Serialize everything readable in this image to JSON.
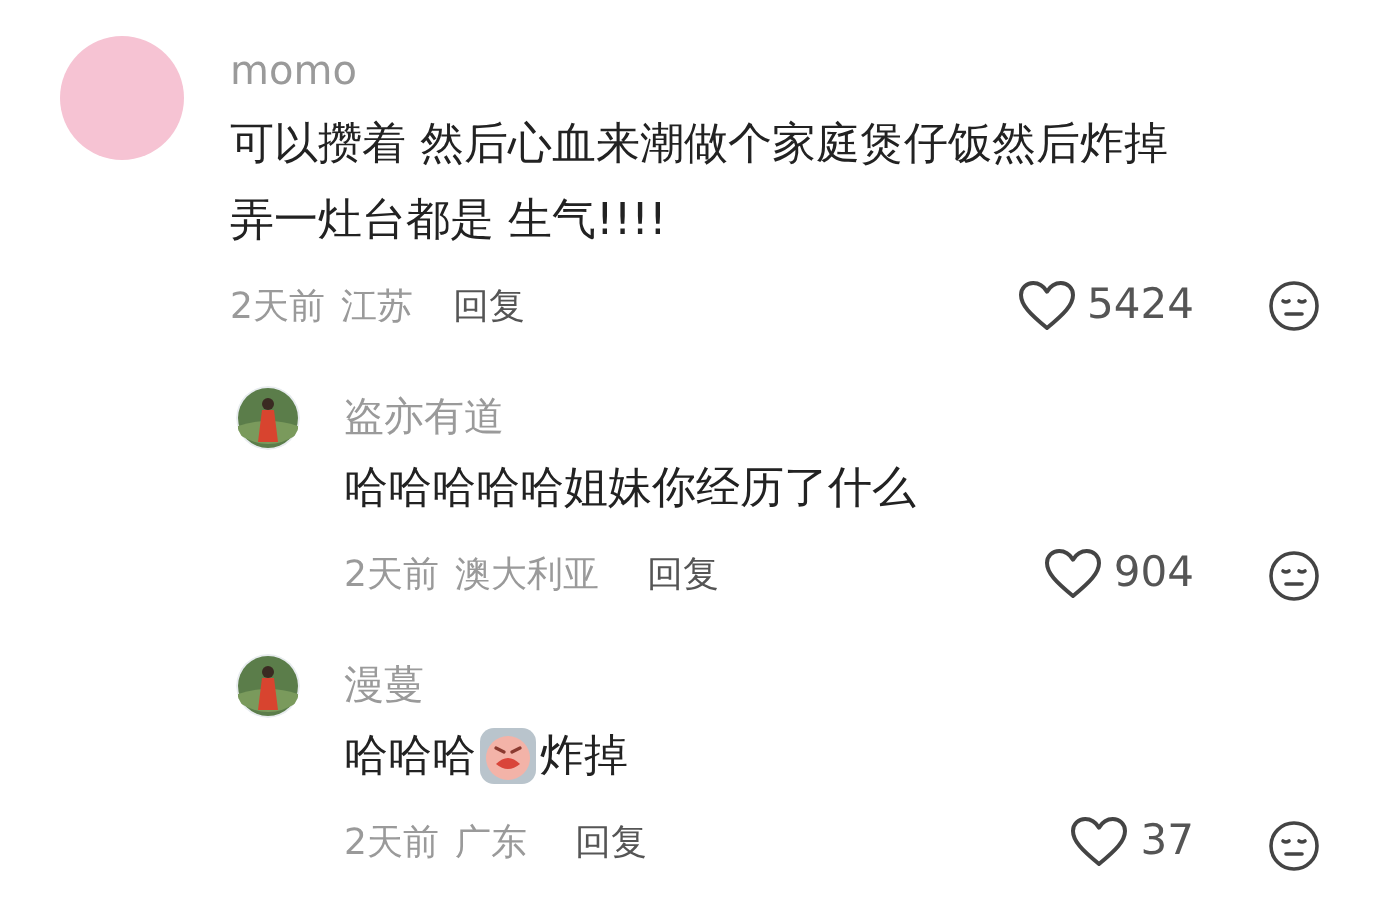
{
  "comments": [
    {
      "kind": "main",
      "avatar": {
        "kind": "plain"
      },
      "name": "momo",
      "lines": [
        "可以攒着 然后心血来潮做个家庭煲仔饭然后炸掉",
        "弄一灶台都是 生气!!!!"
      ],
      "time": "2天前",
      "location": "江苏",
      "reply": "回复",
      "likes": "5424"
    },
    {
      "kind": "reply",
      "avatar": {
        "kind": "picture"
      },
      "name": "盗亦有道",
      "parts": [
        {
          "kind": "text",
          "text": "哈哈哈哈哈姐妹你经历了什么"
        }
      ],
      "time": "2天前",
      "location": "澳大利亚",
      "reply": "回复",
      "likes": "904"
    },
    {
      "kind": "reply",
      "avatar": {
        "kind": "picture"
      },
      "name": "漫蔓",
      "parts": [
        {
          "kind": "text",
          "text": "哈哈哈"
        },
        {
          "kind": "sticker"
        },
        {
          "kind": "text",
          "text": "炸掉"
        }
      ],
      "time": "2天前",
      "location": "广东",
      "reply": "回复",
      "likes": "37"
    }
  ]
}
